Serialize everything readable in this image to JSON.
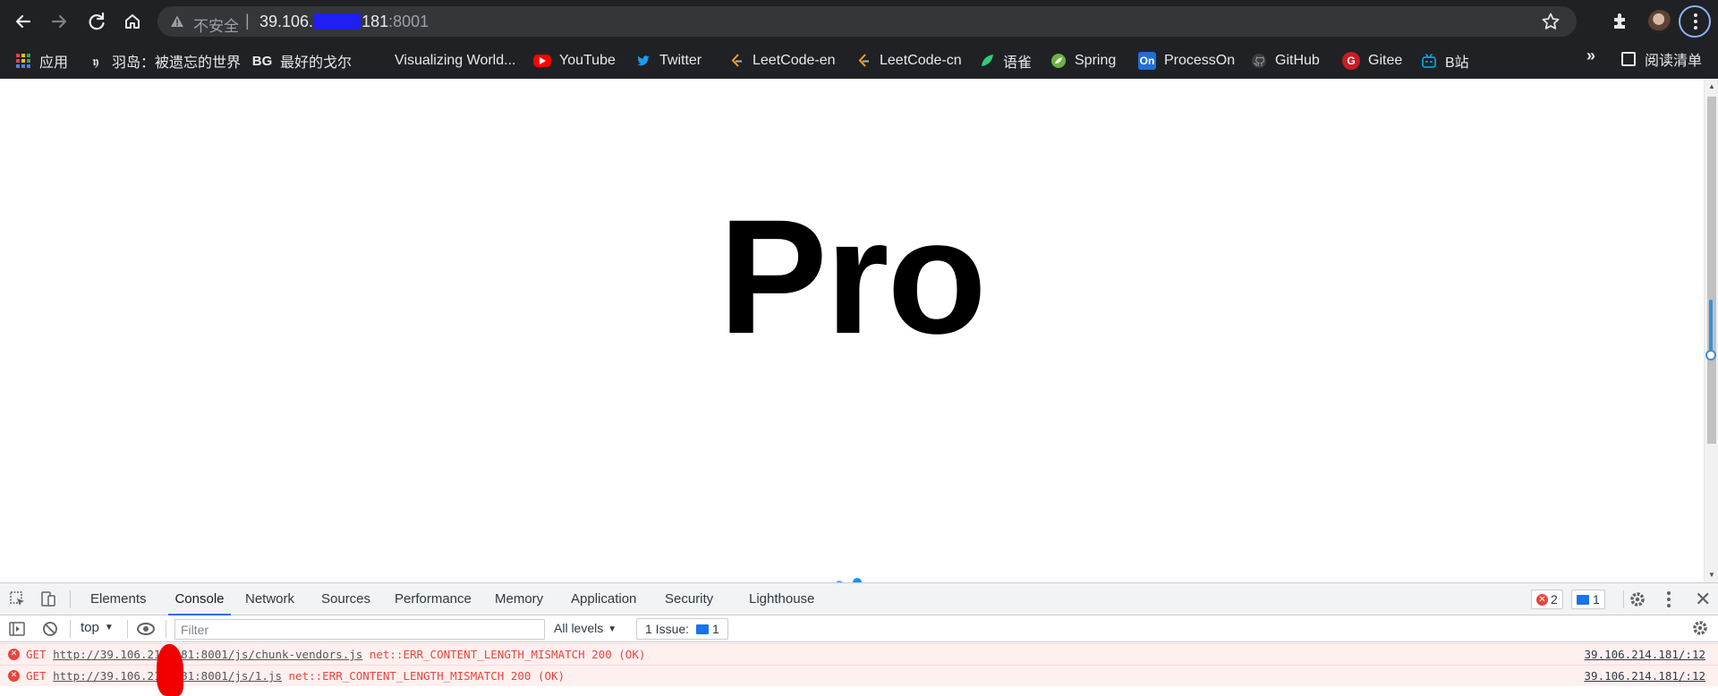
{
  "browser": {
    "address": {
      "security_label": "不安全",
      "separator": "|",
      "host_prefix": "39.106.",
      "host_suffix": "181",
      "port": ":8001"
    },
    "bookmarks": [
      {
        "label": "应用",
        "icon": "apps-grid-icon"
      },
      {
        "label": "羽岛：被遗忘的世界",
        "icon": "yudao-icon"
      },
      {
        "label": "最好的戈尔",
        "icon": "bg-icon"
      },
      {
        "label": "Visualizing World...",
        "icon": "globe-icon"
      },
      {
        "label": "YouTube",
        "icon": "youtube-icon"
      },
      {
        "label": "Twitter",
        "icon": "twitter-icon"
      },
      {
        "label": "LeetCode-en",
        "icon": "leetcode-icon"
      },
      {
        "label": "LeetCode-cn",
        "icon": "leetcode-icon"
      },
      {
        "label": "语雀",
        "icon": "yuque-icon"
      },
      {
        "label": "Spring",
        "icon": "spring-icon"
      },
      {
        "label": "ProcessOn",
        "icon": "processon-icon"
      },
      {
        "label": "GitHub",
        "icon": "github-icon"
      },
      {
        "label": "Gitee",
        "icon": "gitee-icon"
      },
      {
        "label": "B站",
        "icon": "bilibili-icon"
      }
    ],
    "more_bookmarks": "»",
    "reading_list": "阅读清单"
  },
  "page": {
    "hero_text": "Pro"
  },
  "devtools": {
    "tabs": [
      "Elements",
      "Console",
      "Network",
      "Sources",
      "Performance",
      "Memory",
      "Application",
      "Security",
      "Lighthouse"
    ],
    "active_tab": "Console",
    "error_count": "2",
    "message_count": "1",
    "context": "top",
    "filter_placeholder": "Filter",
    "levels": "All levels",
    "issues_label": "1 Issue:",
    "issues_count": "1",
    "logs": [
      {
        "method": "GET",
        "url": "http://39.106.214.181:8001/js/chunk-vendors.js",
        "error": "net::ERR_CONTENT_LENGTH_MISMATCH 200 (OK)",
        "source": "39.106.214.181/:12"
      },
      {
        "method": "GET",
        "url": "http://39.106.214.181:8001/js/1.js",
        "error": "net::ERR_CONTENT_LENGTH_MISMATCH 200 (OK)",
        "source": "39.106.214.181/:12"
      }
    ]
  },
  "colors": {
    "chrome_bg": "#202124",
    "omnibox_bg": "#35363a",
    "accent": "#1a73e8",
    "error": "#e8453c",
    "error_row_bg": "#fff0f0"
  }
}
